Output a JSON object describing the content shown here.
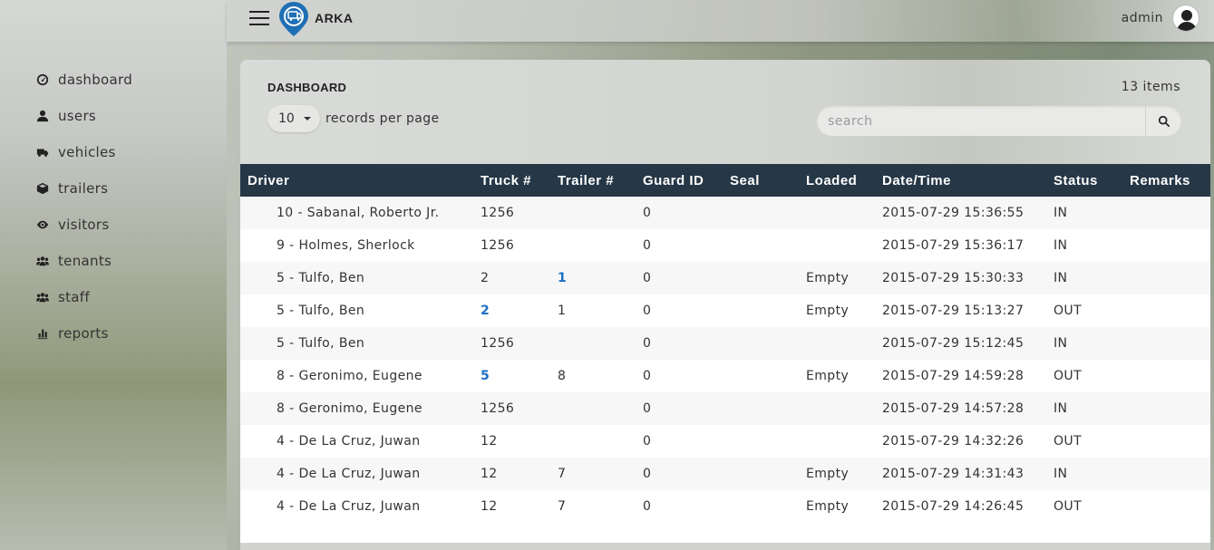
{
  "app": {
    "brand": "ARKA",
    "user_name": "admin"
  },
  "sidebar": {
    "items": [
      {
        "label": "dashboard",
        "icon": "dashboard-icon"
      },
      {
        "label": "users",
        "icon": "user-icon"
      },
      {
        "label": "vehicles",
        "icon": "truck-icon"
      },
      {
        "label": "trailers",
        "icon": "cube-icon"
      },
      {
        "label": "visitors",
        "icon": "eye-icon"
      },
      {
        "label": "tenants",
        "icon": "group-icon"
      },
      {
        "label": "staff",
        "icon": "group-icon"
      },
      {
        "label": "reports",
        "icon": "bar-chart-icon"
      }
    ]
  },
  "panel": {
    "title": "DASHBOARD",
    "items_count": "13 items",
    "per_page_value": "10",
    "per_page_label": "records per page",
    "search_placeholder": "search"
  },
  "table": {
    "columns": [
      "Driver",
      "Truck #",
      "Trailer #",
      "Guard ID",
      "Seal",
      "Loaded",
      "Date/Time",
      "Status",
      "Remarks"
    ],
    "rows": [
      {
        "driver": "10 - Sabanal, Roberto Jr.",
        "truck": "1256",
        "truck_link": false,
        "trailer": "",
        "trailer_link": false,
        "guard": "0",
        "seal": "",
        "loaded": "",
        "datetime": "2015-07-29 15:36:55",
        "status": "IN",
        "remarks": ""
      },
      {
        "driver": "9 - Holmes, Sherlock",
        "truck": "1256",
        "truck_link": false,
        "trailer": "",
        "trailer_link": false,
        "guard": "0",
        "seal": "",
        "loaded": "",
        "datetime": "2015-07-29 15:36:17",
        "status": "IN",
        "remarks": ""
      },
      {
        "driver": "5 - Tulfo, Ben",
        "truck": "2",
        "truck_link": false,
        "trailer": "1",
        "trailer_link": true,
        "guard": "0",
        "seal": "",
        "loaded": "Empty",
        "datetime": "2015-07-29 15:30:33",
        "status": "IN",
        "remarks": ""
      },
      {
        "driver": "5 - Tulfo, Ben",
        "truck": "2",
        "truck_link": true,
        "trailer": "1",
        "trailer_link": false,
        "guard": "0",
        "seal": "",
        "loaded": "Empty",
        "datetime": "2015-07-29 15:13:27",
        "status": "OUT",
        "remarks": ""
      },
      {
        "driver": "5 - Tulfo, Ben",
        "truck": "1256",
        "truck_link": false,
        "trailer": "",
        "trailer_link": false,
        "guard": "0",
        "seal": "",
        "loaded": "",
        "datetime": "2015-07-29 15:12:45",
        "status": "IN",
        "remarks": ""
      },
      {
        "driver": "8 - Geronimo, Eugene",
        "truck": "5",
        "truck_link": true,
        "trailer": "8",
        "trailer_link": false,
        "guard": "0",
        "seal": "",
        "loaded": "Empty",
        "datetime": "2015-07-29 14:59:28",
        "status": "OUT",
        "remarks": ""
      },
      {
        "driver": "8 - Geronimo, Eugene",
        "truck": "1256",
        "truck_link": false,
        "trailer": "",
        "trailer_link": false,
        "guard": "0",
        "seal": "",
        "loaded": "",
        "datetime": "2015-07-29 14:57:28",
        "status": "IN",
        "remarks": ""
      },
      {
        "driver": "4 - De La Cruz, Juwan",
        "truck": "12",
        "truck_link": false,
        "trailer": "",
        "trailer_link": false,
        "guard": "0",
        "seal": "",
        "loaded": "",
        "datetime": "2015-07-29 14:32:26",
        "status": "OUT",
        "remarks": ""
      },
      {
        "driver": "4 - De La Cruz, Juwan",
        "truck": "12",
        "truck_link": false,
        "trailer": "7",
        "trailer_link": false,
        "guard": "0",
        "seal": "",
        "loaded": "Empty",
        "datetime": "2015-07-29 14:31:43",
        "status": "IN",
        "remarks": ""
      },
      {
        "driver": "4 - De La Cruz, Juwan",
        "truck": "12",
        "truck_link": false,
        "trailer": "7",
        "trailer_link": false,
        "guard": "0",
        "seal": "",
        "loaded": "Empty",
        "datetime": "2015-07-29 14:26:45",
        "status": "OUT",
        "remarks": ""
      }
    ]
  },
  "colors": {
    "table_header_bg": "#263746",
    "link": "#1a6fc2",
    "logo": "#1f6fb5"
  }
}
